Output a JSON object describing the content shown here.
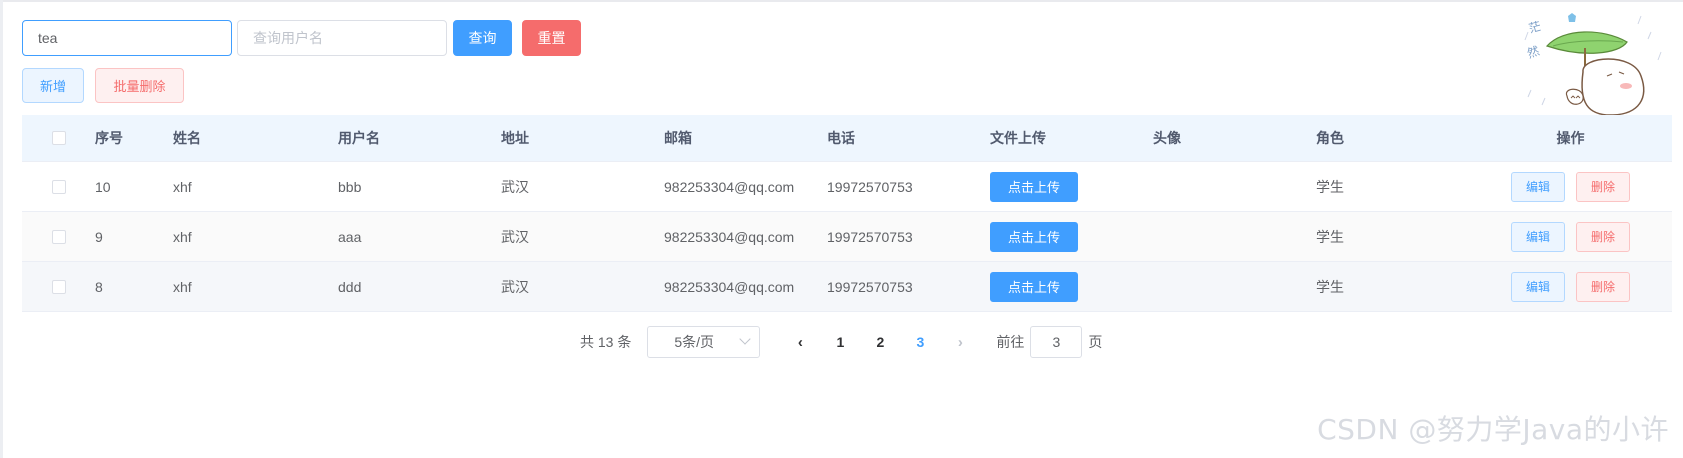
{
  "search": {
    "filter_value": "tea",
    "username_placeholder": "查询用户名",
    "query_label": "查询",
    "reset_label": "重置"
  },
  "actions": {
    "add_label": "新增",
    "batch_delete_label": "批量删除"
  },
  "table": {
    "headers": {
      "no": "序号",
      "name": "姓名",
      "username": "用户名",
      "address": "地址",
      "email": "邮箱",
      "phone": "电话",
      "file_upload": "文件上传",
      "avatar": "头像",
      "role": "角色",
      "operation": "操作"
    },
    "upload_label": "点击上传",
    "edit_label": "编辑",
    "delete_label": "删除",
    "rows": [
      {
        "no": "10",
        "name": "xhf",
        "username": "bbb",
        "address": "武汉",
        "email": "982253304@qq.com",
        "phone": "19972570753",
        "role": "学生"
      },
      {
        "no": "9",
        "name": "xhf",
        "username": "aaa",
        "address": "武汉",
        "email": "982253304@qq.com",
        "phone": "19972570753",
        "role": "学生"
      },
      {
        "no": "8",
        "name": "xhf",
        "username": "ddd",
        "address": "武汉",
        "email": "982253304@qq.com",
        "phone": "19972570753",
        "role": "学生"
      }
    ]
  },
  "pagination": {
    "total_text": "共 13 条",
    "page_size": "5条/页",
    "pages": [
      "1",
      "2",
      "3"
    ],
    "current_page": "3",
    "goto_label": "前往",
    "goto_value": "3",
    "page_suffix": "页"
  },
  "watermark": "CSDN @努力学Java的小许",
  "colors": {
    "primary": "#409eff",
    "danger": "#f56c6c",
    "header_bg": "#eef6fe"
  }
}
